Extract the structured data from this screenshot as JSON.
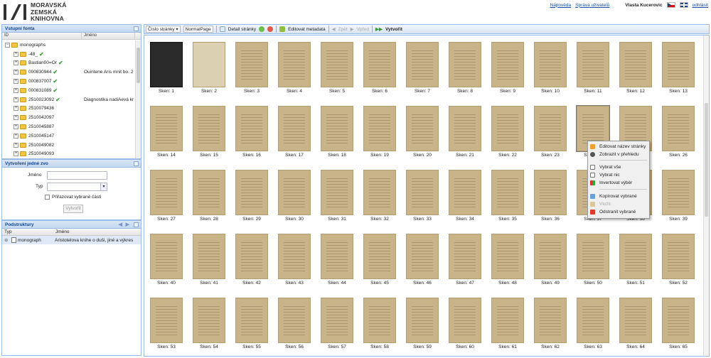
{
  "header": {
    "logo_lines": [
      "MORAVSKÁ",
      "ZEMSKÁ",
      "KNIHOVNA"
    ],
    "help_link": "Nápověda",
    "users_link": "Správa uživatelů",
    "user_name": "Vlasta Kucerovic",
    "logout_link": "odhlásit"
  },
  "input_fonds": {
    "title": "Vstupní fonta",
    "col_id": "ID",
    "col_name": "Jméno",
    "rows": [
      {
        "id": "monographs",
        "check": false,
        "name": ""
      },
      {
        "id": "-48_",
        "check": true,
        "name": ""
      },
      {
        "id": "Bastian00=Or",
        "check": true,
        "name": ""
      },
      {
        "id": "000830944",
        "check": true,
        "name": "Ouintene Aris mnit bo. 2"
      },
      {
        "id": "000837007",
        "check": true,
        "name": ""
      },
      {
        "id": "000831089",
        "check": true,
        "name": ""
      },
      {
        "id": "2510023092",
        "check": true,
        "name": "Diagnostika nadiAevá kr"
      },
      {
        "id": "2510079436",
        "check": false,
        "name": ""
      },
      {
        "id": "2510042097",
        "check": false,
        "name": ""
      },
      {
        "id": "2510045887",
        "check": false,
        "name": ""
      },
      {
        "id": "2510045147",
        "check": false,
        "name": ""
      },
      {
        "id": "2510049082",
        "check": false,
        "name": ""
      },
      {
        "id": "2510049093",
        "check": false,
        "name": ""
      }
    ]
  },
  "create_unit": {
    "title": "Vytvoření jedné zvo",
    "name_label": "Jméno",
    "type_label": "Typ",
    "checkbox_label": "Přiřazovat vybrané části",
    "create_button": "Vytvořit"
  },
  "substructures": {
    "title": "Podstruktury",
    "col_type": "Typ",
    "col_name": "Jméno",
    "rows": [
      {
        "type": "monograph",
        "name": "Aristotelova knihe o duši, jiné a výkres"
      }
    ]
  },
  "toolbar": {
    "page_number_combo": "Číslo stránky",
    "page_type_combo": "NormalPage",
    "detail_label": "Detail stránky",
    "edit_metadata": "Editovat metadata",
    "back": "Zpět",
    "forward": "Vpřed",
    "create": "Vytvořit"
  },
  "scans": [
    "Sken: 1",
    "Sken: 2",
    "Sken: 3",
    "Sken: 4",
    "Sken: 5",
    "Sken: 6",
    "Sken: 7",
    "Sken: 8",
    "Sken: 9",
    "Sken: 10",
    "Sken: 11",
    "Sken: 12",
    "Sken: 13",
    "Sken: 14",
    "Sken: 15",
    "Sken: 16",
    "Sken: 17",
    "Sken: 18",
    "Sken: 19",
    "Sken: 20",
    "Sken: 21",
    "Sken: 22",
    "Sken: 23",
    "Sken: 24",
    "Sken: 25",
    "Sken: 26",
    "Sken: 27",
    "Sken: 28",
    "Sken: 29",
    "Sken: 30",
    "Sken: 31",
    "Sken: 32",
    "Sken: 33",
    "Sken: 34",
    "Sken: 35",
    "Sken: 36",
    "Sken: 37",
    "Sken: 38",
    "Sken: 39",
    "Sken: 40",
    "Sken: 41",
    "Sken: 42",
    "Sken: 43",
    "Sken: 44",
    "Sken: 45",
    "Sken: 46",
    "Sken: 47",
    "Sken: 48",
    "Sken: 49",
    "Sken: 50",
    "Sken: 51",
    "Sken: 52",
    "Sken: 53",
    "Sken: 54",
    "Sken: 55",
    "Sken: 56",
    "Sken: 57",
    "Sken: 58",
    "Sken: 59",
    "Sken: 60",
    "Sken: 61",
    "Sken: 62",
    "Sken: 63",
    "Sken: 64",
    "Sken: 65"
  ],
  "context_menu": {
    "edit_page_name": "Editovat název stránky",
    "show_preview": "Zobrazit v přehledu",
    "select_all": "Vybrat vše",
    "select_none": "Vybrat nic",
    "invert_selection": "Invertovat výběr",
    "copy_selected": "Kopírovat vybrané",
    "paste": "Vložit",
    "delete_selected": "Odstranit vybrané"
  }
}
